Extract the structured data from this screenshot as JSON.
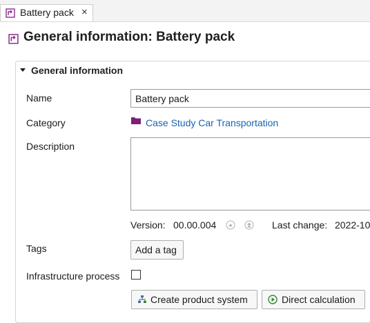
{
  "tab": {
    "label": "Battery pack",
    "close": "×"
  },
  "header": {
    "title": "General information: Battery pack"
  },
  "section": {
    "title": "General information"
  },
  "fields": {
    "name_label": "Name",
    "name_value": "Battery pack",
    "category_label": "Category",
    "category_value": "Case Study Car Transportation",
    "description_label": "Description",
    "description_value": "",
    "version_label": "Version:",
    "version_value": "00.00.004",
    "last_change_label": "Last change:",
    "last_change_value": "2022-10",
    "tags_label": "Tags",
    "add_tag_label": "Add a tag",
    "infrastructure_label": "Infrastructure process",
    "infrastructure_checked": false
  },
  "actions": {
    "create_product_system": "Create product system",
    "direct_calculation": "Direct calculation"
  },
  "icons": {
    "tab": "process-icon",
    "header": "process-icon",
    "category": "folder-icon",
    "version_up": "version-increment-icon",
    "version_up_major": "version-increment-major-icon",
    "product_system": "product-system-icon",
    "calculate": "play-icon"
  },
  "colors": {
    "process_icon": "#8e2b8e",
    "folder": "#7a1f7a",
    "link": "#1764b3",
    "calc_icon": "#2e8b2e"
  }
}
